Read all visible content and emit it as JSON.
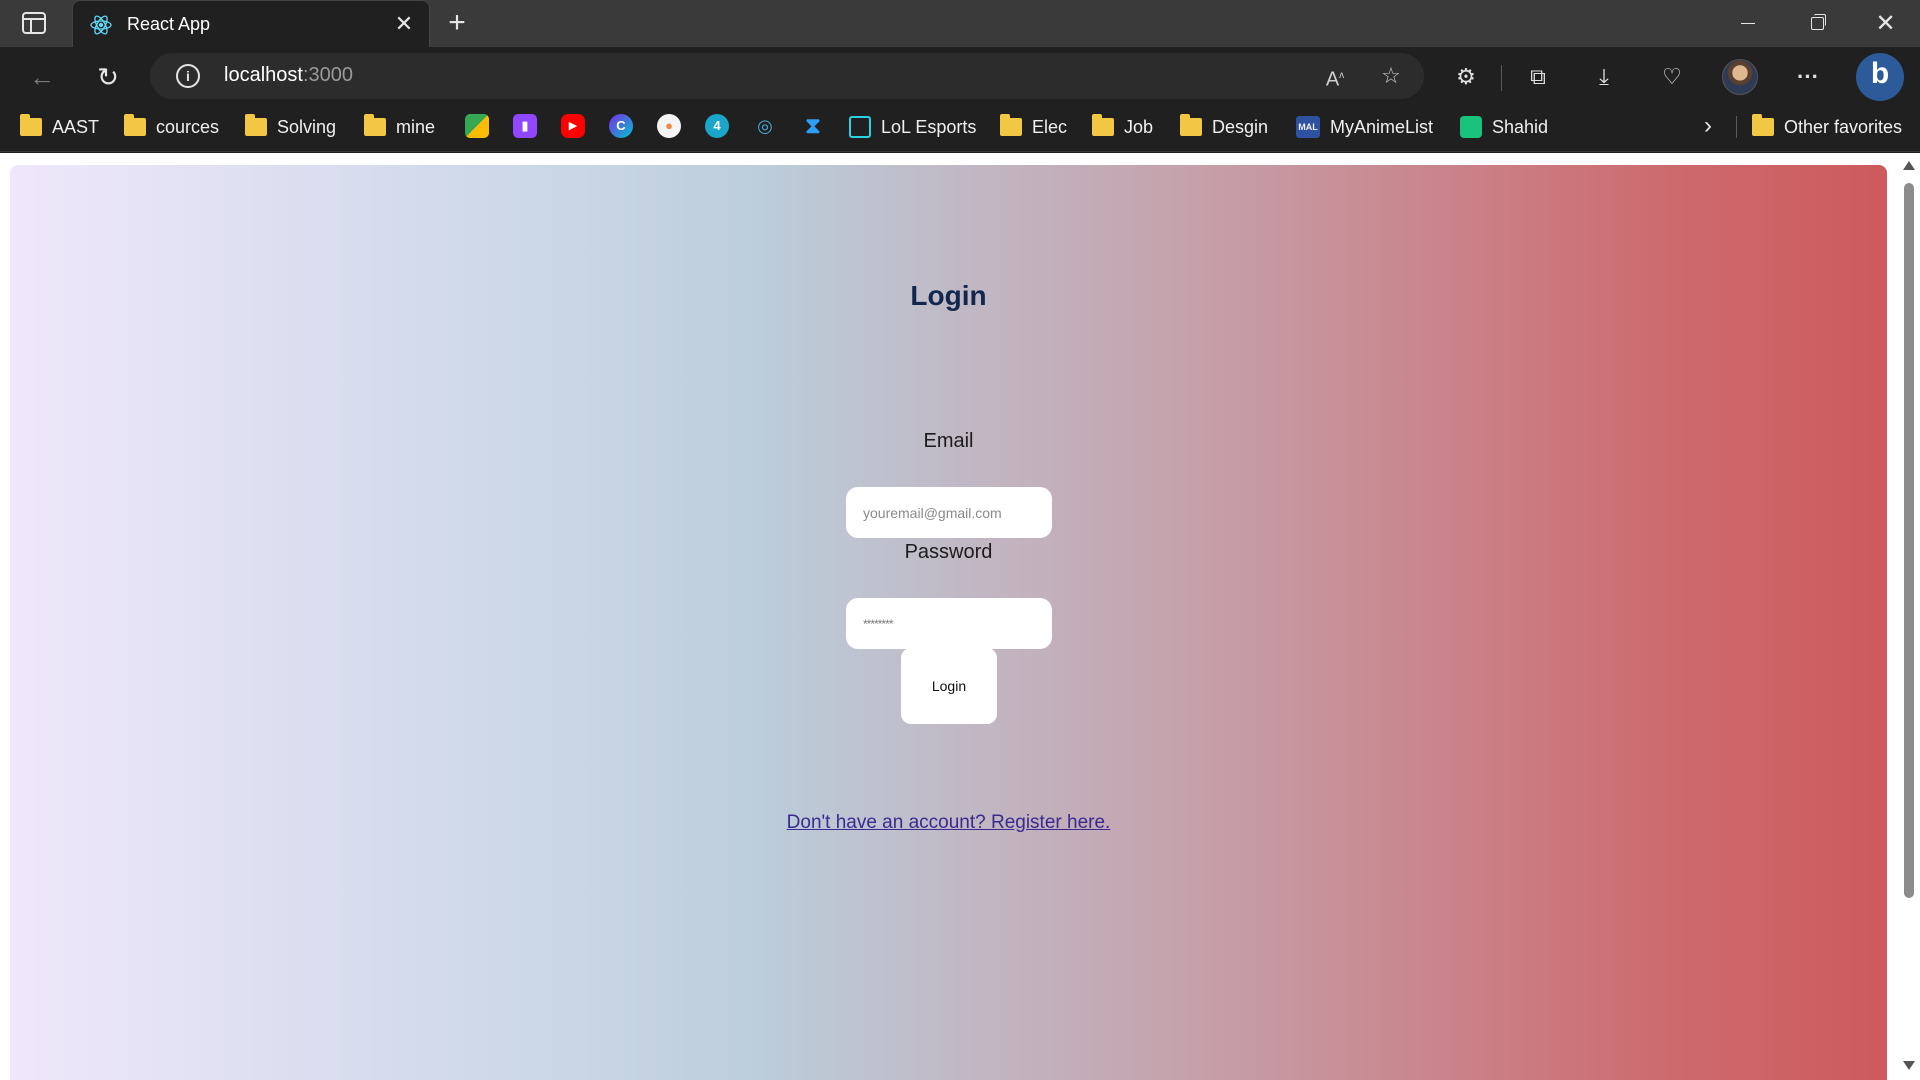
{
  "browser": {
    "tab_title": "React App",
    "url_host": "localhost",
    "url_port": ":3000",
    "bookmarks": [
      {
        "label": "AAST",
        "type": "folder"
      },
      {
        "label": "cources",
        "type": "folder"
      },
      {
        "label": "Solving",
        "type": "folder"
      },
      {
        "label": "mine",
        "type": "folder"
      },
      {
        "label": "",
        "type": "icon",
        "icon": "google-meet-icon"
      },
      {
        "label": "",
        "type": "icon",
        "icon": "twitch-icon"
      },
      {
        "label": "",
        "type": "icon",
        "icon": "youtube-icon"
      },
      {
        "label": "",
        "type": "icon",
        "icon": "canva-icon"
      },
      {
        "label": "",
        "type": "icon",
        "icon": "palette-icon"
      },
      {
        "label": "",
        "type": "icon",
        "icon": "codeforces-icon"
      },
      {
        "label": "",
        "type": "icon",
        "icon": "dolphin-icon"
      },
      {
        "label": "",
        "type": "icon",
        "icon": "vscode-icon"
      },
      {
        "label": "LoL Esports",
        "type": "site"
      },
      {
        "label": "Elec",
        "type": "folder"
      },
      {
        "label": "Job",
        "type": "folder"
      },
      {
        "label": "Desgin",
        "type": "folder"
      },
      {
        "label": "MyAnimeList",
        "type": "site"
      },
      {
        "label": "Shahid",
        "type": "site"
      },
      {
        "label": "Other favorites",
        "type": "folder"
      }
    ],
    "mal_badge": "MAL"
  },
  "page": {
    "title": "Login",
    "email_label": "Email",
    "email_placeholder": "youremail@gmail.com",
    "password_label": "Password",
    "password_placeholder": "********",
    "login_button": "Login",
    "register_link": "Don't have an account? Register here."
  },
  "colors": {
    "title_color": "#12284e",
    "link_color": "#3a2a8f",
    "gradient_start": "#efe7fb",
    "gradient_end": "#cd5a5c"
  }
}
